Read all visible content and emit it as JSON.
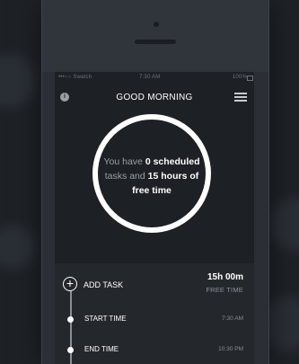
{
  "status": {
    "carrier": "•••○○ Swatch",
    "time": "7:30 AM",
    "battery": "100%"
  },
  "header": {
    "title": "GOOD MORNING"
  },
  "summary": {
    "prefix": "You have ",
    "task_count": "0 scheduled",
    "middle": "tasks and ",
    "hours": "15 hours of",
    "suffix": "free time"
  },
  "tasks": {
    "add_label": "ADD TASK",
    "free_hours": "15h 00m",
    "free_label": "FREE TIME",
    "start_label": "START TIME",
    "start_time": "7:30 AM",
    "end_label": "END TIME",
    "end_time": "10:30 PM"
  },
  "colors": {
    "background": "#1e2227",
    "screen": "#1d2024",
    "accent": "#ffffff",
    "muted": "#9aa0a6"
  }
}
